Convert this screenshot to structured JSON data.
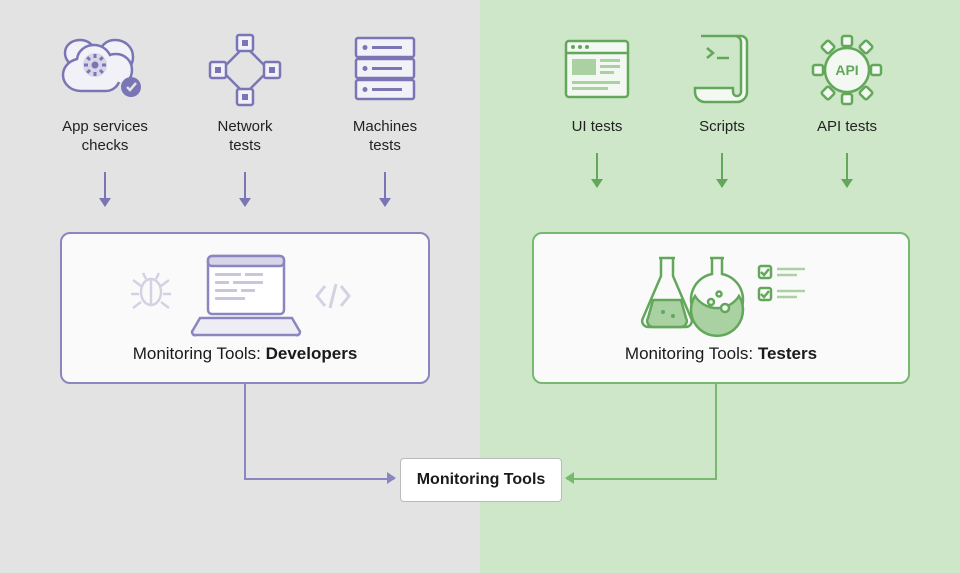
{
  "left": {
    "items": [
      {
        "label": "App services\nchecks"
      },
      {
        "label": "Network\ntests"
      },
      {
        "label": "Machines\ntests"
      }
    ],
    "box_prefix": "Monitoring Tools: ",
    "box_bold": "Developers"
  },
  "right": {
    "items": [
      {
        "label": "UI tests"
      },
      {
        "label": "Scripts"
      },
      {
        "label": "API tests"
      }
    ],
    "box_prefix": "Monitoring Tools: ",
    "box_bold": "Testers"
  },
  "final": "Monitoring Tools",
  "colors": {
    "purple": "#7a76b5",
    "green": "#63a75b"
  }
}
